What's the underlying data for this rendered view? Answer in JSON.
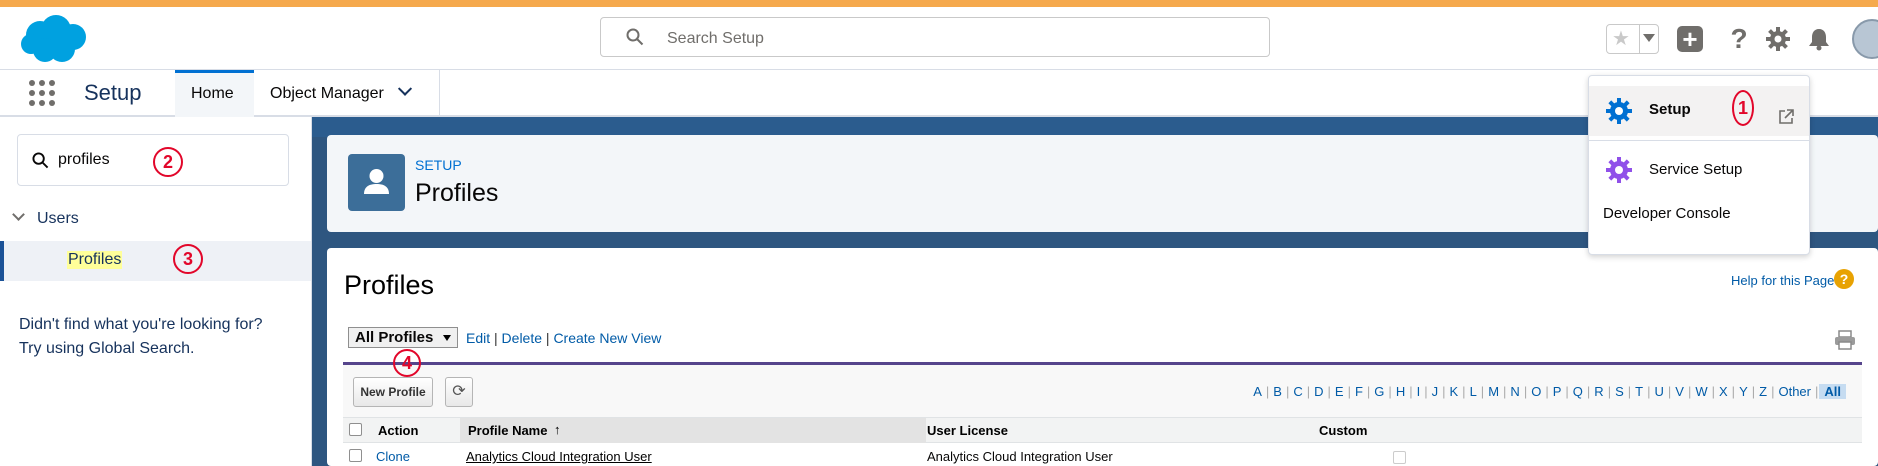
{
  "header": {
    "search_placeholder": "Search Setup",
    "brand_color": "#00a1e0"
  },
  "nav": {
    "app_name": "Setup",
    "tabs": [
      {
        "label": "Home",
        "active": true
      },
      {
        "label": "Object Manager",
        "active": false
      }
    ]
  },
  "sidebar": {
    "search_value": "profiles",
    "group": "Users",
    "item": "Profiles",
    "help_line1": "Didn't find what you're looking for?",
    "help_line2": "Try using Global Search."
  },
  "markers": [
    "1",
    "2",
    "3",
    "4"
  ],
  "page_header": {
    "supertitle": "SETUP",
    "title": "Profiles"
  },
  "content": {
    "title": "Profiles",
    "help_link": "Help for this Page",
    "view_selected": "All Profiles",
    "view_links": [
      "Edit",
      "Delete",
      "Create New View"
    ],
    "new_button": "New Profile",
    "alphabet": [
      "A",
      "B",
      "C",
      "D",
      "E",
      "F",
      "G",
      "H",
      "I",
      "J",
      "K",
      "L",
      "M",
      "N",
      "O",
      "P",
      "Q",
      "R",
      "S",
      "T",
      "U",
      "V",
      "W",
      "X",
      "Y",
      "Z",
      "Other",
      "All"
    ],
    "selected_letter": "All",
    "columns": {
      "action": "Action",
      "profile_name": "Profile Name",
      "sort_indicator": "↑",
      "user_license": "User License",
      "custom": "Custom"
    },
    "rows": [
      {
        "action": "Clone",
        "profile_name": "Analytics Cloud Integration User",
        "user_license": "Analytics Cloud Integration User"
      }
    ]
  },
  "menu": {
    "items": [
      "Setup",
      "Service Setup",
      "Developer Console"
    ]
  }
}
